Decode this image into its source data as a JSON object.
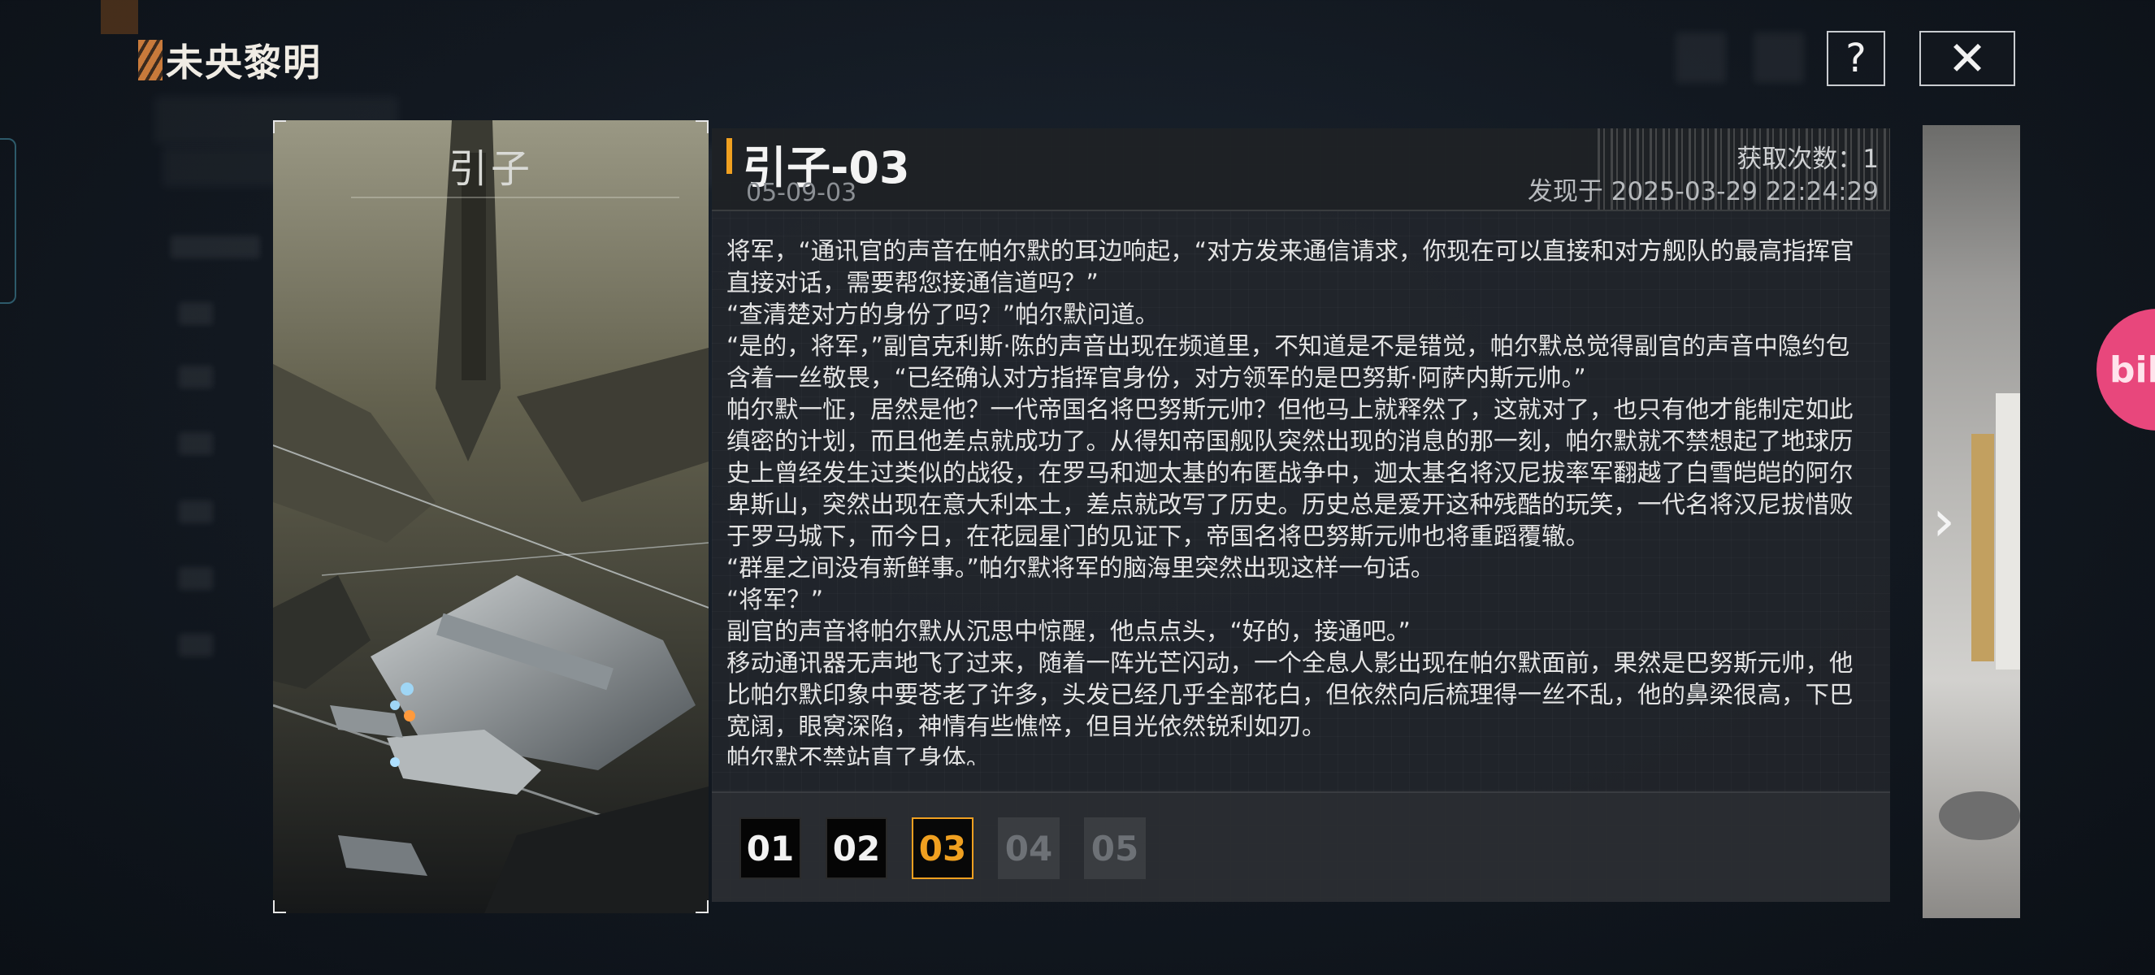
{
  "top": {
    "title": "未央黎明",
    "help_icon": "?",
    "close_icon": "✕"
  },
  "card": {
    "title": "引子"
  },
  "entry": {
    "title": "引子-03",
    "code": "05-09-03",
    "count_label": "获取次数：1",
    "found_label": "发现于 2025-03-29 22:24:29",
    "paragraphs": [
      "将军，“通讯官的声音在帕尔默的耳边响起，“对方发来通信请求，你现在可以直接和对方舰队的最高指挥官直接对话，需要帮您接通信道吗？”",
      "“查清楚对方的身份了吗？”帕尔默问道。",
      "“是的，将军，”副官克利斯·陈的声音出现在频道里，不知道是不是错觉，帕尔默总觉得副官的声音中隐约包含着一丝敬畏，“已经确认对方指挥官身份，对方领军的是巴努斯·阿萨内斯元帅。”",
      "帕尔默一怔，居然是他？一代帝国名将巴努斯元帅？但他马上就释然了，这就对了，也只有他才能制定如此缜密的计划，而且他差点就成功了。从得知帝国舰队突然出现的消息的那一刻，帕尔默就不禁想起了地球历史上曾经发生过类似的战役，在罗马和迦太基的布匿战争中，迦太基名将汉尼拔率军翻越了白雪皑皑的阿尔卑斯山，突然出现在意大利本土，差点就改写了历史。历史总是爱开这种残酷的玩笑，一代名将汉尼拔惜败于罗马城下，而今日，在花园星门的见证下，帝国名将巴努斯元帅也将重蹈覆辙。",
      "“群星之间没有新鲜事。”帕尔默将军的脑海里突然出现这样一句话。",
      "“将军？”",
      "副官的声音将帕尔默从沉思中惊醒，他点点头，“好的，接通吧。”",
      "移动通讯器无声地飞了过来，随着一阵光芒闪动，一个全息人影出现在帕尔默面前，果然是巴努斯元帅，他比帕尔默印象中要苍老了许多，头发已经几乎全部花白，但依然向后梳理得一丝不乱，他的鼻梁很高，下巴宽阔，眼窝深陷，神情有些憔悴，但目光依然锐利如刃。",
      "帕尔默不禁站直了身体。"
    ]
  },
  "pager": {
    "pages": [
      {
        "label": "01",
        "state": "read"
      },
      {
        "label": "02",
        "state": "read"
      },
      {
        "label": "03",
        "state": "current"
      },
      {
        "label": "04",
        "state": "locked"
      },
      {
        "label": "05",
        "state": "locked"
      }
    ]
  },
  "nav": {
    "next_icon": "›"
  },
  "overlay": {
    "badge_text": "bili"
  },
  "colors": {
    "accent": "#f0a020",
    "panel": "#22262b",
    "bili": "#e8477c"
  }
}
